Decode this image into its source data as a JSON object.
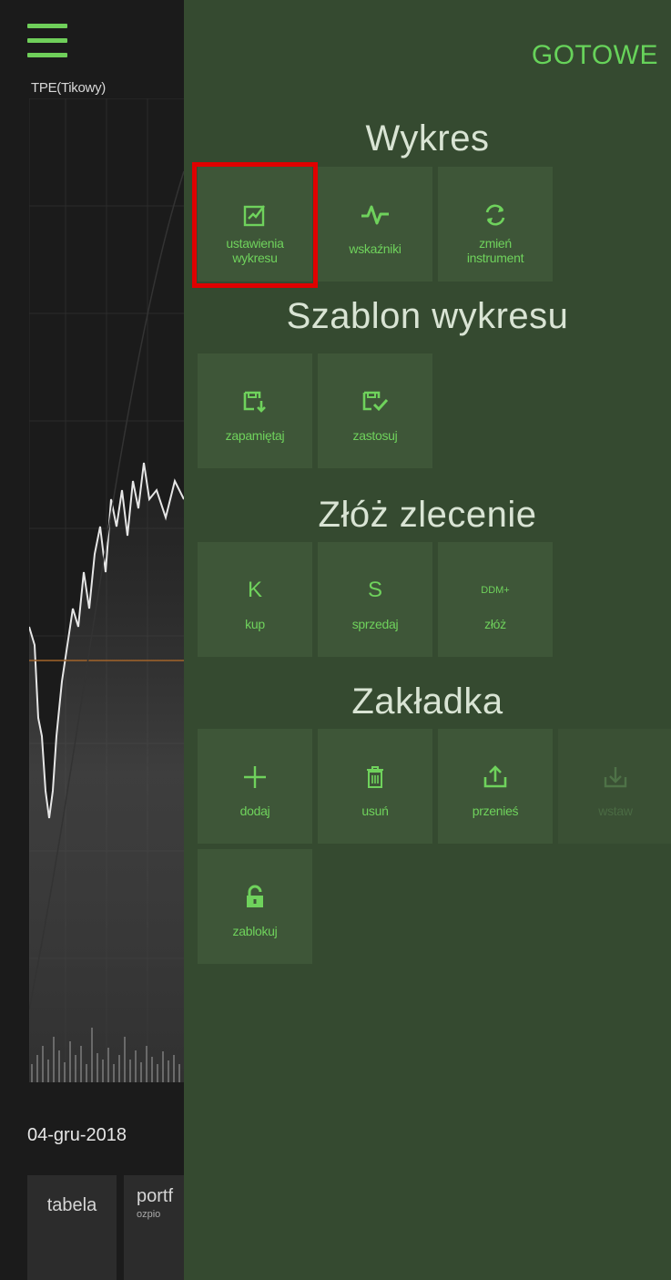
{
  "chart": {
    "instrument_label": "TPE(Tikowy)",
    "date_label": "04-gru-2018",
    "bottom_tabs": [
      "tabela",
      "portf"
    ],
    "bottom_tab_sub": "ozpio"
  },
  "menu": {
    "done_label": "GOTOWE",
    "sections": {
      "wykres": {
        "title": "Wykres",
        "tiles": [
          {
            "label_lines": [
              "ustawienia",
              "wykresu"
            ],
            "icon": "chart-settings-icon",
            "highlighted": true
          },
          {
            "label_lines": [
              "wskaźniki"
            ],
            "icon": "pulse-icon"
          },
          {
            "label_lines": [
              "zmień",
              "instrument"
            ],
            "icon": "refresh-icon"
          }
        ]
      },
      "szablon": {
        "title": "Szablon wykresu",
        "tiles": [
          {
            "label_lines": [
              "zapamiętaj"
            ],
            "icon": "save-template-icon"
          },
          {
            "label_lines": [
              "zastosuj"
            ],
            "icon": "apply-template-icon"
          }
        ]
      },
      "zlecenie": {
        "title": "Złóż zlecenie",
        "tiles": [
          {
            "glyph": "K",
            "label_lines": [
              "kup"
            ]
          },
          {
            "glyph": "S",
            "label_lines": [
              "sprzedaj"
            ]
          },
          {
            "glyph": "DDM+",
            "label_lines": [
              "złóż"
            ]
          }
        ]
      },
      "zakladka": {
        "title": "Zakładka",
        "tiles": [
          {
            "label_lines": [
              "dodaj"
            ],
            "icon": "plus-icon"
          },
          {
            "label_lines": [
              "usuń"
            ],
            "icon": "trash-icon"
          },
          {
            "label_lines": [
              "przenieś"
            ],
            "icon": "upload-icon"
          },
          {
            "label_lines": [
              "wstaw"
            ],
            "icon": "download-icon",
            "disabled": true
          },
          {
            "label_lines": [
              "zablokuj"
            ],
            "icon": "lock-icon"
          }
        ]
      }
    }
  },
  "colors": {
    "accent": "#6fd25c",
    "panel_bg": "#354a30",
    "tile_bg": "#3e5638",
    "highlight": "#e00000"
  }
}
